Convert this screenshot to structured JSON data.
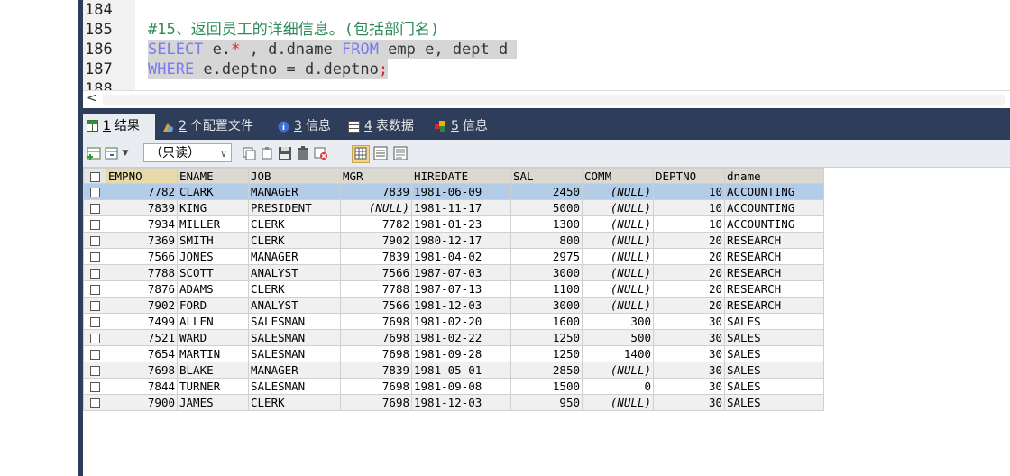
{
  "editor": {
    "lines": [
      {
        "num": "184",
        "code": ""
      },
      {
        "num": "185",
        "code": "#15、返回员工的详细信息。(包括部门名)"
      },
      {
        "num": "186",
        "kw1": "SELECT",
        "code_a": " e.",
        "star": "*",
        "code_b": " , d.dname ",
        "kw2": "FROM",
        "code_c": " emp e, dept d "
      },
      {
        "num": "187",
        "kw1": "WHERE",
        "code_a": " e.deptno = d.deptno",
        "semi": ";"
      },
      {
        "num": "188",
        "code": ""
      }
    ]
  },
  "tabs": [
    {
      "num": "1",
      "label": "结果"
    },
    {
      "num": "2",
      "label": "个配置文件"
    },
    {
      "num": "3",
      "label": "信息"
    },
    {
      "num": "4",
      "label": "表数据"
    },
    {
      "num": "5",
      "label": "信息"
    }
  ],
  "toolbar": {
    "mode_select": "（只读）"
  },
  "grid": {
    "columns": [
      "EMPNO",
      "ENAME",
      "JOB",
      "MGR",
      "HIREDATE",
      "SAL",
      "COMM",
      "DEPTNO",
      "dname"
    ],
    "rows": [
      [
        "7782",
        "CLARK",
        "MANAGER",
        "7839",
        "1981-06-09",
        "2450",
        "(NULL)",
        "10",
        "ACCOUNTING"
      ],
      [
        "7839",
        "KING",
        "PRESIDENT",
        "(NULL)",
        "1981-11-17",
        "5000",
        "(NULL)",
        "10",
        "ACCOUNTING"
      ],
      [
        "7934",
        "MILLER",
        "CLERK",
        "7782",
        "1981-01-23",
        "1300",
        "(NULL)",
        "10",
        "ACCOUNTING"
      ],
      [
        "7369",
        "SMITH",
        "CLERK",
        "7902",
        "1980-12-17",
        "800",
        "(NULL)",
        "20",
        "RESEARCH"
      ],
      [
        "7566",
        "JONES",
        "MANAGER",
        "7839",
        "1981-04-02",
        "2975",
        "(NULL)",
        "20",
        "RESEARCH"
      ],
      [
        "7788",
        "SCOTT",
        "ANALYST",
        "7566",
        "1987-07-03",
        "3000",
        "(NULL)",
        "20",
        "RESEARCH"
      ],
      [
        "7876",
        "ADAMS",
        "CLERK",
        "7788",
        "1987-07-13",
        "1100",
        "(NULL)",
        "20",
        "RESEARCH"
      ],
      [
        "7902",
        "FORD",
        "ANALYST",
        "7566",
        "1981-12-03",
        "3000",
        "(NULL)",
        "20",
        "RESEARCH"
      ],
      [
        "7499",
        "ALLEN",
        "SALESMAN",
        "7698",
        "1981-02-20",
        "1600",
        "300",
        "30",
        "SALES"
      ],
      [
        "7521",
        "WARD",
        "SALESMAN",
        "7698",
        "1981-02-22",
        "1250",
        "500",
        "30",
        "SALES"
      ],
      [
        "7654",
        "MARTIN",
        "SALESMAN",
        "7698",
        "1981-09-28",
        "1250",
        "1400",
        "30",
        "SALES"
      ],
      [
        "7698",
        "BLAKE",
        "MANAGER",
        "7839",
        "1981-05-01",
        "2850",
        "(NULL)",
        "30",
        "SALES"
      ],
      [
        "7844",
        "TURNER",
        "SALESMAN",
        "7698",
        "1981-09-08",
        "1500",
        "0",
        "30",
        "SALES"
      ],
      [
        "7900",
        "JAMES",
        "CLERK",
        "7698",
        "1981-12-03",
        "950",
        "(NULL)",
        "30",
        "SALES"
      ]
    ]
  }
}
